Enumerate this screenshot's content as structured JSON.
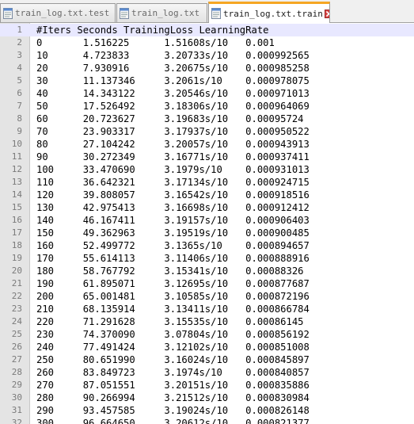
{
  "tabs": [
    {
      "label": "train_log.txt.test",
      "active": false
    },
    {
      "label": "train_log.txt",
      "active": false
    },
    {
      "label": "train_log.txt.train",
      "active": true
    }
  ],
  "lines": [
    "#Iters Seconds TrainingLoss LearningRate",
    "0       1.516225      1.51608s/10   0.001",
    "10      4.723833      3.20733s/10   0.000992565",
    "20      7.930916      3.20675s/10   0.000985258",
    "30      11.137346     3.2061s/10    0.000978075",
    "40      14.343122     3.20546s/10   0.000971013",
    "50      17.526492     3.18306s/10   0.000964069",
    "60      20.723627     3.19683s/10   0.00095724",
    "70      23.903317     3.17937s/10   0.000950522",
    "80      27.104242     3.20057s/10   0.000943913",
    "90      30.272349     3.16771s/10   0.000937411",
    "100     33.470690     3.1979s/10    0.000931013",
    "110     36.642321     3.17134s/10   0.000924715",
    "120     39.808057     3.16542s/10   0.000918516",
    "130     42.975413     3.16698s/10   0.000912412",
    "140     46.167411     3.19157s/10   0.000906403",
    "150     49.362963     3.19519s/10   0.000900485",
    "160     52.499772     3.1365s/10    0.000894657",
    "170     55.614113     3.11406s/10   0.000888916",
    "180     58.767792     3.15341s/10   0.00088326",
    "190     61.895071     3.12695s/10   0.000877687",
    "200     65.001481     3.10585s/10   0.000872196",
    "210     68.135914     3.13411s/10   0.000866784",
    "220     71.291628     3.15535s/10   0.00086145",
    "230     74.370090     3.07804s/10   0.000856192",
    "240     77.491424     3.12102s/10   0.000851008",
    "250     80.651990     3.16024s/10   0.000845897",
    "260     83.849723     3.1974s/10    0.000840857",
    "270     87.051551     3.20151s/10   0.000835886",
    "280     90.266994     3.21512s/10   0.000830984",
    "290     93.457585     3.19024s/10   0.000826148",
    "300     96.664650     3.20612s/10   0.000821377"
  ]
}
